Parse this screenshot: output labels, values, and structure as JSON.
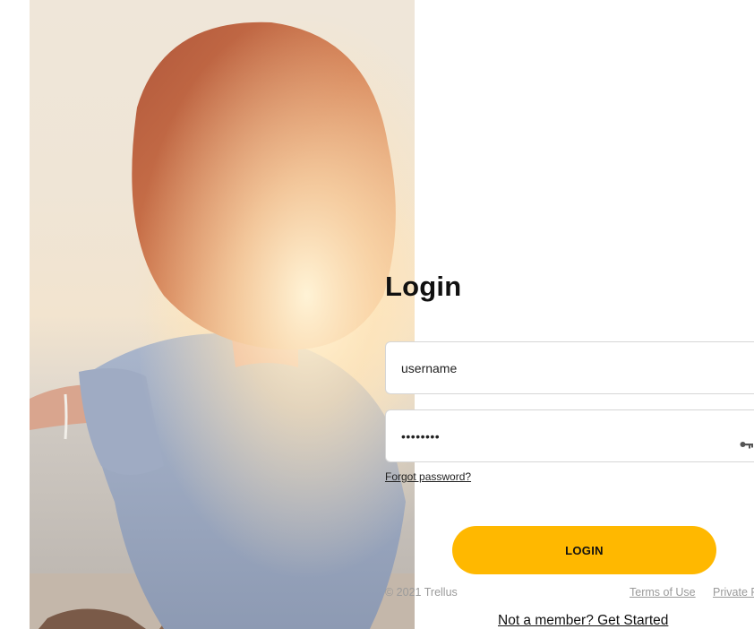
{
  "login": {
    "title": "Login",
    "username_value": "username",
    "password_value": "••••••••",
    "forgot_password": "Forgot password?",
    "login_button": "LOGIN",
    "signup_link": "Not a member? Get Started"
  },
  "footer": {
    "copyright": "© 2021 Trellus",
    "terms": "Terms of Use",
    "private": "Private P"
  },
  "icons": {
    "password_toggle": "key-icon"
  },
  "colors": {
    "accent": "#ffb800",
    "field_border": "#d6d6d6",
    "muted_text": "#9a9a9a"
  }
}
